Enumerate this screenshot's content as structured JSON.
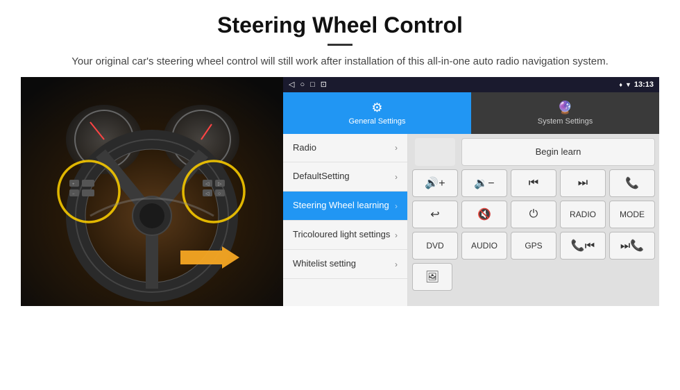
{
  "header": {
    "title": "Steering Wheel Control",
    "subtitle": "Your original car's steering wheel control will still work after installation of this all-in-one auto radio navigation system."
  },
  "status_bar": {
    "left_icons": [
      "◁",
      "○",
      "□",
      "⊡"
    ],
    "time": "13:13",
    "right_icons": [
      "♦",
      "▼"
    ]
  },
  "tabs": [
    {
      "id": "general",
      "label": "General Settings",
      "active": true
    },
    {
      "id": "system",
      "label": "System Settings",
      "active": false
    }
  ],
  "menu_items": [
    {
      "id": "radio",
      "label": "Radio",
      "active": false
    },
    {
      "id": "default",
      "label": "DefaultSetting",
      "active": false
    },
    {
      "id": "steering",
      "label": "Steering Wheel learning",
      "active": true
    },
    {
      "id": "tricoloured",
      "label": "Tricoloured light settings",
      "active": false
    },
    {
      "id": "whitelist",
      "label": "Whitelist setting",
      "active": false
    }
  ],
  "controls": {
    "begin_learn": "Begin learn",
    "row1": [
      {
        "id": "vol_up",
        "label": "🔊+",
        "type": "icon"
      },
      {
        "id": "vol_down",
        "label": "🔉−",
        "type": "icon"
      },
      {
        "id": "prev_track",
        "label": "⏮",
        "type": "icon"
      },
      {
        "id": "next_track",
        "label": "⏭",
        "type": "icon"
      },
      {
        "id": "phone",
        "label": "📞",
        "type": "icon"
      }
    ],
    "row2": [
      {
        "id": "hang_up",
        "label": "↩",
        "type": "icon"
      },
      {
        "id": "mute",
        "label": "🔇",
        "type": "icon"
      },
      {
        "id": "power",
        "label": "⏻",
        "type": "icon"
      },
      {
        "id": "radio_btn",
        "label": "RADIO",
        "type": "text"
      },
      {
        "id": "mode_btn",
        "label": "MODE",
        "type": "text"
      }
    ],
    "row3": [
      {
        "id": "dvd_btn",
        "label": "DVD",
        "type": "text"
      },
      {
        "id": "audio_btn",
        "label": "AUDIO",
        "type": "text"
      },
      {
        "id": "gps_btn",
        "label": "GPS",
        "type": "text"
      },
      {
        "id": "tel_prev",
        "label": "📞⏮",
        "type": "icon"
      },
      {
        "id": "tel_next",
        "label": "⏭📞",
        "type": "icon"
      }
    ],
    "row4_icon": "🖼"
  }
}
